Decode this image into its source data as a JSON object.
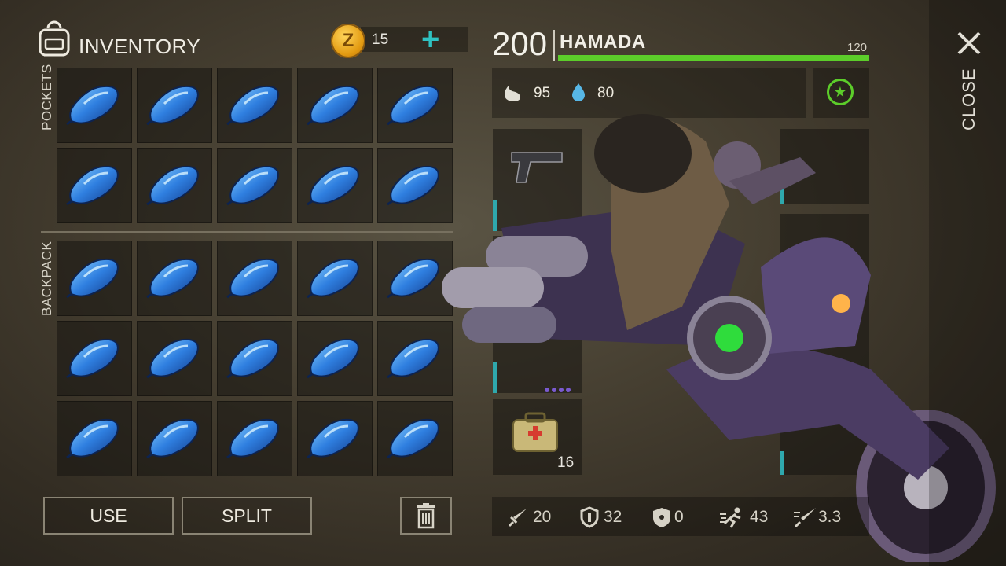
{
  "inventory": {
    "title": "INVENTORY",
    "coins": "15",
    "pockets_label": "POCKETS",
    "backpack_label": "BACKPACK",
    "pocket_items": [
      {
        "icon": "blue-blob-icon"
      },
      {
        "icon": "blue-blob-icon"
      },
      {
        "icon": "blue-blob-icon"
      },
      {
        "icon": "blue-blob-icon"
      },
      {
        "icon": "blue-blob-icon"
      },
      {
        "icon": "blue-blob-icon"
      },
      {
        "icon": "blue-blob-icon"
      },
      {
        "icon": "blue-blob-icon"
      },
      {
        "icon": "blue-blob-icon"
      },
      {
        "icon": "blue-blob-icon"
      }
    ],
    "backpack_items": [
      {
        "icon": "blue-blob-icon"
      },
      {
        "icon": "blue-blob-icon"
      },
      {
        "icon": "blue-blob-icon"
      },
      {
        "icon": "blue-blob-icon"
      },
      {
        "icon": "blue-blob-icon"
      },
      {
        "icon": "blue-blob-icon"
      },
      {
        "icon": "blue-blob-icon"
      },
      {
        "icon": "blue-blob-icon"
      },
      {
        "icon": "blue-blob-icon"
      },
      {
        "icon": "blue-blob-icon"
      },
      {
        "icon": "blue-blob-icon"
      },
      {
        "icon": "blue-blob-icon"
      },
      {
        "icon": "blue-blob-icon"
      },
      {
        "icon": "blue-blob-icon"
      },
      {
        "icon": "blue-blob-icon"
      }
    ]
  },
  "actions": {
    "use_label": "USE",
    "split_label": "SPLIT"
  },
  "character": {
    "health": "200",
    "name": "HAMADA",
    "xp_max": "120",
    "xp_fraction": 1.0,
    "hunger": "95",
    "thirst": "80"
  },
  "equipment": {
    "medkit_count": "16"
  },
  "combat_stats": {
    "attack": "20",
    "defense": "32",
    "radiation": "0",
    "speed": "43",
    "attack_speed": "3.3"
  },
  "close_label": "CLOSE",
  "colors": {
    "accent_teal": "#2fc2c2",
    "xp_green": "#5ccd2a",
    "item_blue": "#2f7fe0"
  }
}
